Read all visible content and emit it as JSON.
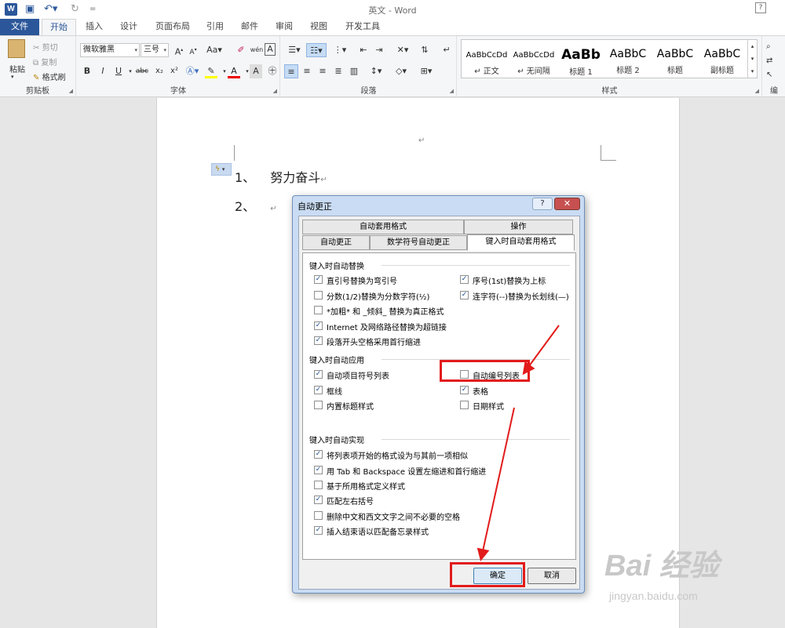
{
  "titlebar": {
    "title": "英文 - Word",
    "app_icon": "W",
    "help": "?"
  },
  "tabs": [
    "文件",
    "开始",
    "插入",
    "设计",
    "页面布局",
    "引用",
    "邮件",
    "审阅",
    "视图",
    "开发工具"
  ],
  "clipboard": {
    "paste": "粘贴",
    "cut": "剪切",
    "copy": "复制",
    "format_painter": "格式刷",
    "group": "剪贴板"
  },
  "font": {
    "name": "微软雅黑",
    "size": "三号",
    "group": "字体",
    "buttons": [
      "B",
      "I",
      "U",
      "abc",
      "x₂",
      "x²"
    ]
  },
  "paragraph": {
    "group": "段落"
  },
  "styles": {
    "group": "样式",
    "items": [
      {
        "sample": "AaBbCcDd",
        "name": "↵ 正文"
      },
      {
        "sample": "AaBbCcDd",
        "name": "↵ 无间隔"
      },
      {
        "sample": "AaBb",
        "name": "标题 1"
      },
      {
        "sample": "AaBbC",
        "name": "标题 2"
      },
      {
        "sample": "AaBbC",
        "name": "标题"
      },
      {
        "sample": "AaBbC",
        "name": "副标题"
      }
    ]
  },
  "editing": {
    "group": "编"
  },
  "document": {
    "item1_number": "1、",
    "item1_text": "努力奋斗",
    "item2_number": "2、",
    "para_mark": "↵"
  },
  "dialog": {
    "title": "自动更正",
    "help": "?",
    "close": "✕",
    "tabs_top": [
      "自动套用格式",
      "操作"
    ],
    "tabs_bottom": [
      "自动更正",
      "数学符号自动更正",
      "键入时自动套用格式"
    ],
    "section1": {
      "title": "键入时自动替换",
      "left": [
        {
          "label": "直引号替换为弯引号",
          "checked": true
        },
        {
          "label": "分数(1/2)替换为分数字符(½)",
          "checked": false
        },
        {
          "label": "*加粗* 和 _倾斜_ 替换为真正格式",
          "checked": false
        },
        {
          "label": "Internet 及网络路径替换为超链接",
          "checked": true
        },
        {
          "label": "段落开头空格采用首行缩进",
          "checked": true
        }
      ],
      "right": [
        {
          "label": "序号(1st)替换为上标",
          "checked": true
        },
        {
          "label": "连字符(--)替换为长划线(—)",
          "checked": true
        }
      ]
    },
    "section2": {
      "title": "键入时自动应用",
      "left": [
        {
          "label": "自动项目符号列表",
          "checked": true
        },
        {
          "label": "框线",
          "checked": true
        },
        {
          "label": "内置标题样式",
          "checked": false
        }
      ],
      "right": [
        {
          "label": "自动编号列表",
          "checked": false
        },
        {
          "label": "表格",
          "checked": true
        },
        {
          "label": "日期样式",
          "checked": false
        }
      ]
    },
    "section3": {
      "title": "键入时自动实现",
      "items": [
        {
          "label": "将列表项开始的格式设为与其前一项相似",
          "checked": true
        },
        {
          "label": "用 Tab 和 Backspace 设置左缩进和首行缩进",
          "checked": true
        },
        {
          "label": "基于所用格式定义样式",
          "checked": false
        },
        {
          "label": "匹配左右括号",
          "checked": true
        },
        {
          "label": "删除中文和西文文字之间不必要的空格",
          "checked": false
        },
        {
          "label": "插入结束语以匹配备忘录样式",
          "checked": true
        }
      ]
    },
    "ok": "确定",
    "cancel": "取消"
  },
  "watermark": {
    "main": "Bai 经验",
    "sub": "jingyan.baidu.com"
  },
  "colors": {
    "accent": "#2b579a",
    "annotation": "#e21b1b"
  }
}
